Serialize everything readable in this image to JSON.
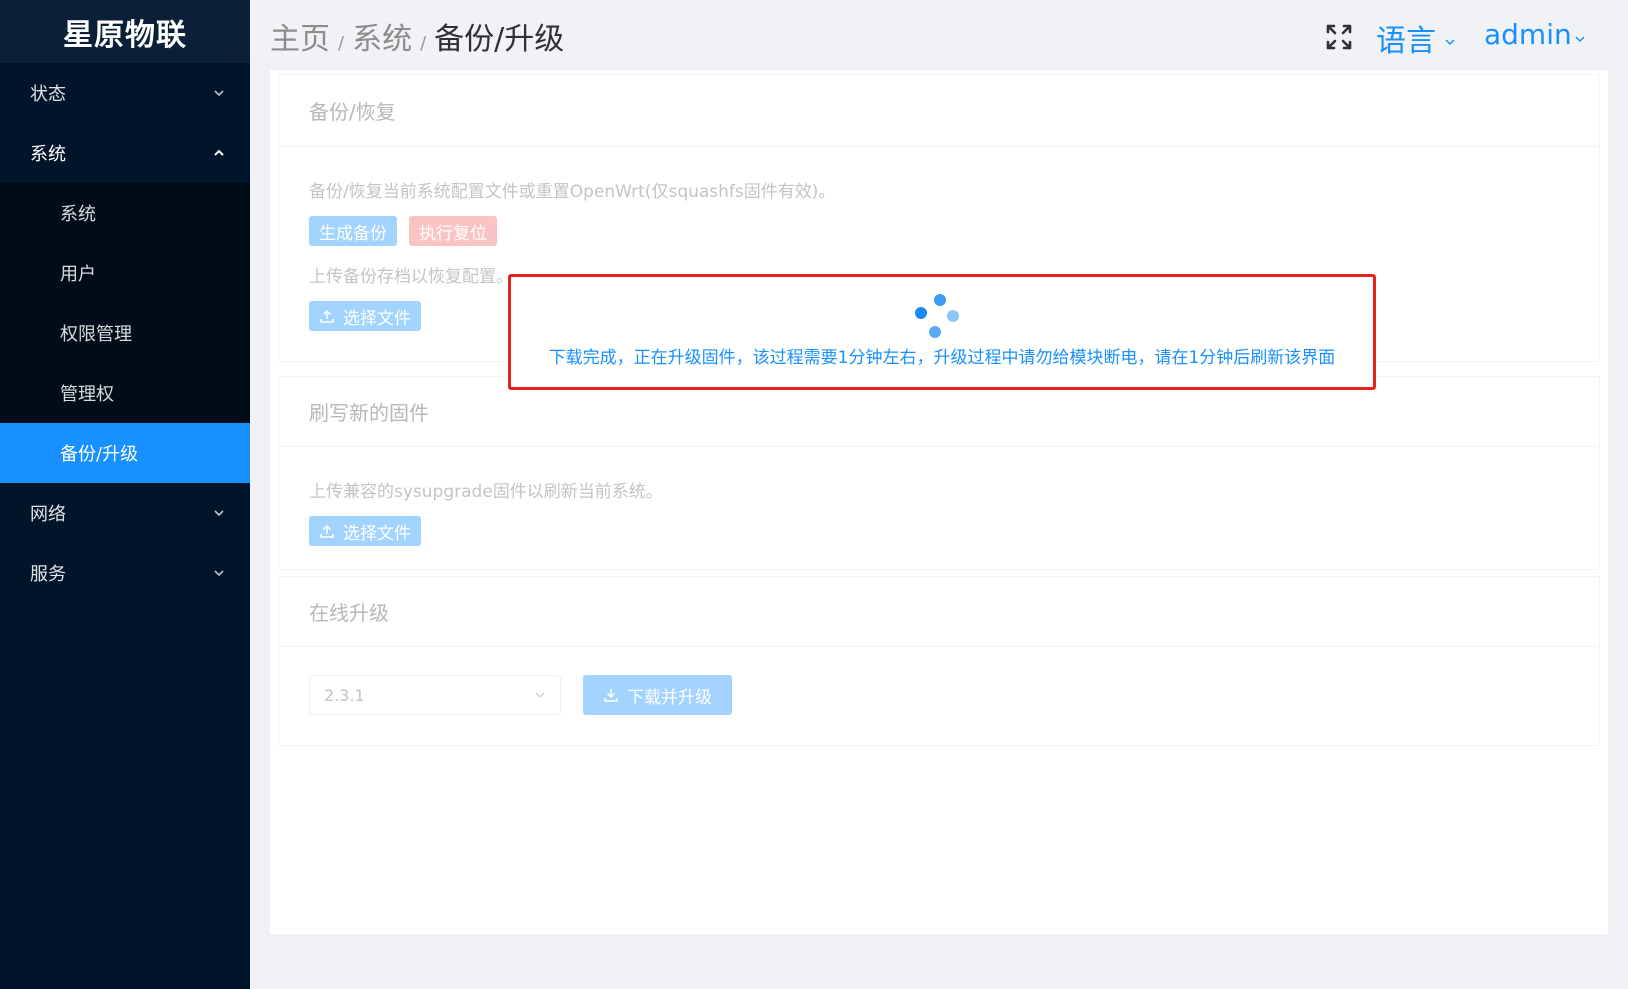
{
  "logo": "星原物联",
  "sidebar": {
    "groups": [
      {
        "label": "状态"
      },
      {
        "label": "系统"
      },
      {
        "label": "网络"
      },
      {
        "label": "服务"
      }
    ],
    "sub_items": [
      {
        "label": "系统"
      },
      {
        "label": "用户"
      },
      {
        "label": "权限管理"
      },
      {
        "label": "管理权"
      },
      {
        "label": "备份/升级"
      }
    ]
  },
  "header": {
    "breadcrumb": [
      "主页",
      "系统",
      "备份/升级"
    ],
    "separator": "/",
    "language": "语言",
    "user": "admin"
  },
  "backup": {
    "title": "备份/恢复",
    "desc": "备份/恢复当前系统配置文件或重置OpenWrt(仅squashfs固件有效)。",
    "generate_btn": "生成备份",
    "reset_btn": "执行复位",
    "upload_desc": "上传备份存档以恢复配置。",
    "choose_file_btn": "选择文件"
  },
  "flash": {
    "title": "刷写新的固件",
    "desc": "上传兼容的sysupgrade固件以刷新当前系统。",
    "choose_file_btn": "选择文件"
  },
  "online": {
    "title": "在线升级",
    "version": "2.3.1",
    "download_btn": "下载并升级"
  },
  "loading": {
    "text": "下载完成，正在升级固件，该过程需要1分钟左右，升级过程中请勿给模块断电，请在1分钟后刷新该界面"
  },
  "colors": {
    "sidebar_bg": "#001529",
    "accent": "#1890ff",
    "highlight_border": "#e8231d"
  },
  "icons": {
    "fullscreen": "fullscreen-icon",
    "upload": "upload-icon",
    "download": "download-icon",
    "chevron": "chevron-down-icon"
  }
}
